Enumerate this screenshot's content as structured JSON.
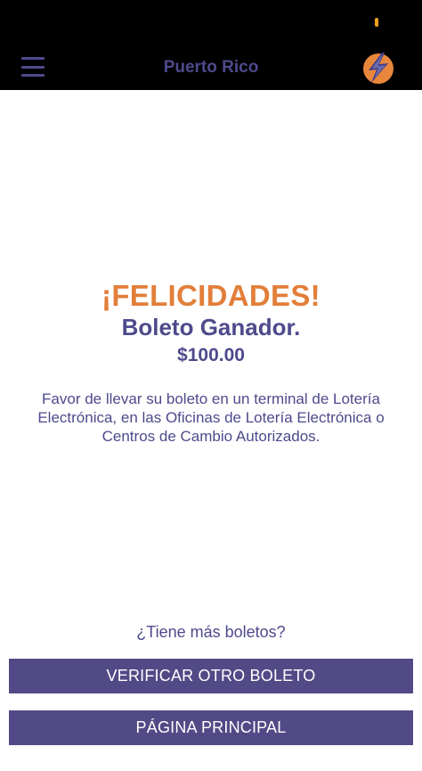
{
  "header": {
    "title": "Puerto Rico",
    "menu_icon": "hamburger-menu-icon",
    "logo_icon": "lightning-bolt-logo",
    "colors": {
      "bar_background": "#000000",
      "title": "#4e4a8c",
      "logo_orange": "#e8873c",
      "logo_blue": "#3e3a8c"
    }
  },
  "result": {
    "headline": "¡FELICIDADES!",
    "subheadline": "Boleto Ganador.",
    "amount": "$100.00",
    "message": "Favor de llevar su boleto en un terminal de Lotería Electrónica, en las Oficinas de Lotería Electrónica o Centros de Cambio Autorizados.",
    "colors": {
      "headline": "#e27f3a",
      "text": "#4e4a8c"
    }
  },
  "footer": {
    "question": "¿Tiene más boletos?",
    "verify_button_label": "VERIFICAR OTRO BOLETO",
    "home_button_label": "PÁGINA PRINCIPAL",
    "button_color": "#524a86"
  }
}
